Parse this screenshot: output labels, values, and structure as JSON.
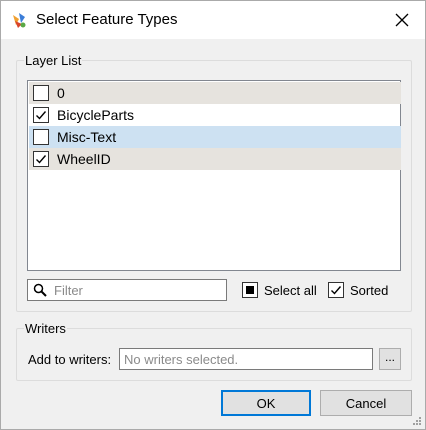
{
  "window": {
    "title": "Select Feature Types"
  },
  "layer_list": {
    "label": "Layer List",
    "items": [
      {
        "label": "0",
        "checked": false,
        "selected": false
      },
      {
        "label": "BicycleParts",
        "checked": true,
        "selected": false
      },
      {
        "label": "Misc-Text",
        "checked": false,
        "selected": true
      },
      {
        "label": "WheelID",
        "checked": true,
        "selected": false
      }
    ],
    "filter_placeholder": "Filter",
    "select_all_label": "Select all",
    "sorted_label": "Sorted",
    "sorted_checked": true
  },
  "writers": {
    "label": "Writers",
    "add_label": "Add to writers:",
    "placeholder": "No writers selected.",
    "browse_label": "..."
  },
  "buttons": {
    "ok": "OK",
    "cancel": "Cancel"
  },
  "icons": {
    "app": "fme-workbench-icon",
    "close": "close-icon",
    "search": "search-icon",
    "select_all": "select-all-icon",
    "resize": "resize-grip-icon"
  },
  "colors": {
    "selected_row": "#cde1f2",
    "alt_row": "#e6e3de",
    "default_button_border": "#0078d7"
  }
}
